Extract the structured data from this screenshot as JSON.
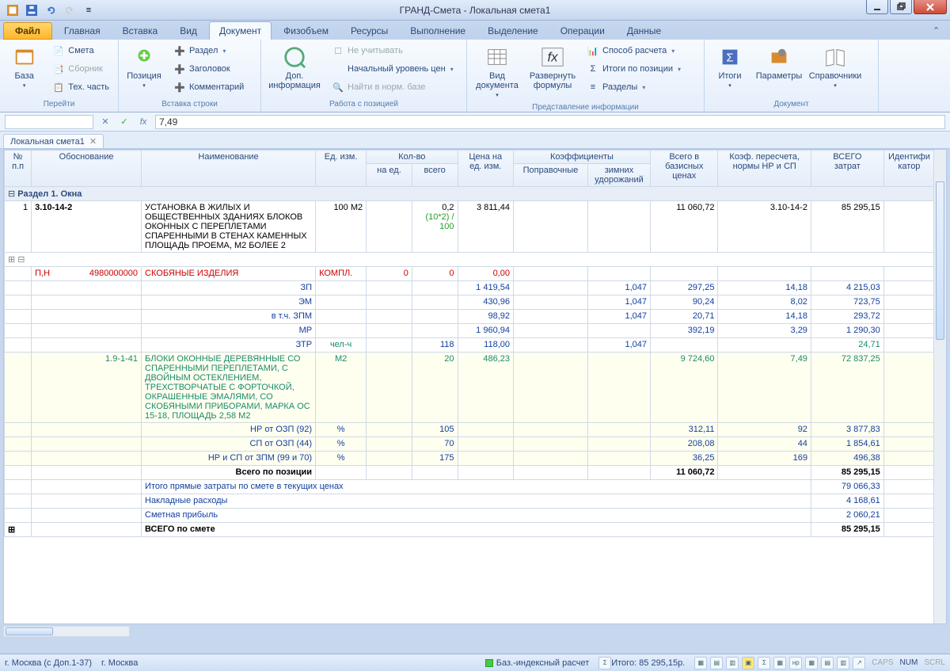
{
  "app": {
    "title": "ГРАНД-Смета - Локальная смета1"
  },
  "tabs": {
    "file": "Файл",
    "items": [
      "Главная",
      "Вставка",
      "Вид",
      "Документ",
      "Физобъем",
      "Ресурсы",
      "Выполнение",
      "Выделение",
      "Операции",
      "Данные"
    ],
    "active": "Документ"
  },
  "ribbon": {
    "g1": {
      "label": "Перейти",
      "base": "База",
      "s1": "Смета",
      "s2": "Сборник",
      "s3": "Тех. часть"
    },
    "g2": {
      "label": "Вставка строки",
      "pos": "Позиция",
      "r1": "Раздел",
      "r2": "Заголовок",
      "r3": "Комментарий"
    },
    "g3": {
      "label": "Работа с позицией",
      "info": "Доп.\nинформация",
      "c1": "Не учитывать",
      "c2": "Начальный уровень цен",
      "c3": "Найти в норм. базе"
    },
    "g4": {
      "label": "Представление информации",
      "v": "Вид\nдокумента",
      "f": "Развернуть\nформулы",
      "p1": "Способ расчета",
      "p2": "Итоги по позиции",
      "p3": "Разделы"
    },
    "g5": {
      "label": "Документ",
      "b1": "Итоги",
      "b2": "Параметры",
      "b3": "Справочники"
    }
  },
  "formula": {
    "value": "7,49"
  },
  "doctab": {
    "name": "Локальная смета1"
  },
  "headers": {
    "c1": "№\nп.п",
    "c2": "Обоснование",
    "c3": "Наименование",
    "c4": "Ед. изм.",
    "c5": "Кол-во",
    "c5a": "на ед.",
    "c5b": "всего",
    "c6": "Цена на\nед. изм.",
    "c7": "Коэффициенты",
    "c7a": "Поправочные",
    "c7b": "зимних\nудорожаний",
    "c8": "Всего в\nбазисных\nценах",
    "c9": "Коэф. пересчета,\nнормы НР и СП",
    "c10": "ВСЕГО\nзатрат",
    "c11": "Идентифи\nкатор"
  },
  "section": "Раздел 1. Окна",
  "rows": {
    "r1": {
      "num": "1",
      "obs": "3.10-14-2",
      "name": "УСТАНОВКА В ЖИЛЫХ И ОБЩЕСТВЕННЫХ ЗДАНИЯХ БЛОКОВ ОКОННЫХ С ПЕРЕПЛЕТАМИ СПАРЕННЫМИ В СТЕНАХ КАМЕННЫХ ПЛОЩАДЬ ПРОЕМА, М2 БОЛЕЕ 2",
      "unit": "100 М2",
      "qty": "0,2",
      "formula": "(10*2) / 100",
      "price": "3 811,44",
      "base": "11 060,72",
      "coef": "3.10-14-2",
      "total": "85 295,15"
    },
    "r2": {
      "obs": "П,Н",
      "obs2": "4980000000",
      "name": "СКОБЯНЫЕ ИЗДЕЛИЯ",
      "unit": "КОМПЛ.",
      "q1": "0",
      "q2": "0",
      "price": "0,00"
    },
    "r3": {
      "name": "ЗП",
      "price": "1 419,54",
      "k": "1,047",
      "base": "297,25",
      "coef": "14,18",
      "total": "4 215,03"
    },
    "r4": {
      "name": "ЭМ",
      "price": "430,96",
      "k": "1,047",
      "base": "90,24",
      "coef": "8,02",
      "total": "723,75"
    },
    "r5": {
      "name": "в т.ч. ЗПМ",
      "price": "98,92",
      "k": "1,047",
      "base": "20,71",
      "coef": "14,18",
      "total": "293,72"
    },
    "r6": {
      "name": "МР",
      "price": "1 960,94",
      "base": "392,19",
      "coef": "3,29",
      "total": "1 290,30"
    },
    "r7": {
      "name": "ЗТР",
      "unit": "чел-ч",
      "q2": "118",
      "price": "118,00",
      "k": "1,047",
      "total": "24,71"
    },
    "r8": {
      "obs": "1.9-1-41",
      "name": "БЛОКИ ОКОННЫЕ ДЕРЕВЯННЫЕ СО СПАРЕННЫМИ ПЕРЕПЛЕТАМИ, С ДВОЙНЫМ ОСТЕКЛЕНИЕМ, ТРЕХСТВОРЧАТЫЕ С ФОРТОЧКОЙ, ОКРАШЕННЫЕ ЭМАЛЯМИ, СО СКОБЯНЫМИ ПРИБОРАМИ, МАРКА ОС 15-18, ПЛОЩАДЬ 2,58 М2",
      "unit": "М2",
      "q2": "20",
      "price": "486,23",
      "base": "9 724,60",
      "coef": "7,49",
      "total": "72 837,25"
    },
    "r9": {
      "name": "НР от ОЗП (92)",
      "unit": "%",
      "q2": "105",
      "base": "312,11",
      "coef": "92",
      "total": "3 877,83"
    },
    "r10": {
      "name": "СП от ОЗП (44)",
      "unit": "%",
      "q2": "70",
      "base": "208,08",
      "coef": "44",
      "total": "1 854,61"
    },
    "r11": {
      "name": "НР и СП от ЗПМ (99 и 70)",
      "unit": "%",
      "q2": "175",
      "base": "36,25",
      "coef": "169",
      "total": "496,38"
    },
    "r12": {
      "name": "Всего по позиции",
      "base": "11 060,72",
      "total": "85 295,15"
    },
    "r13": {
      "name": "Итого прямые затраты по смете в текущих ценах",
      "total": "79 066,33"
    },
    "r14": {
      "name": "Накладные расходы",
      "total": "4 168,61"
    },
    "r15": {
      "name": "Сметная прибыль",
      "total": "2 060,21"
    },
    "r16": {
      "name": "ВСЕГО по смете",
      "total": "85 295,15"
    }
  },
  "status": {
    "left1": "г. Москва (с Доп.1-37)",
    "left2": "г. Москва",
    "mode": "Баз.-индексный расчет",
    "total": "Итого: 85 295,15р.",
    "ind1": "CAPS",
    "ind2": "NUM",
    "ind3": "SCRL"
  }
}
